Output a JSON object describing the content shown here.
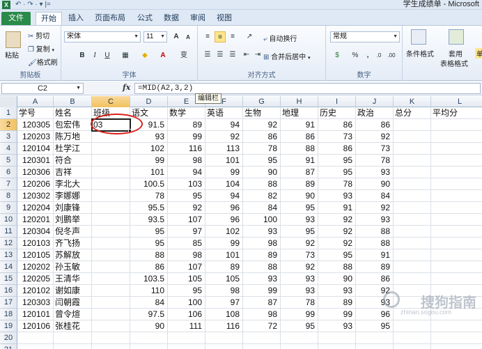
{
  "titlebar": {
    "app_icon": "X",
    "quick_access": "↶ · ↷ · ▾ |=",
    "title": "学生成绩单 - Microsoft"
  },
  "tabs": [
    "文件",
    "开始",
    "插入",
    "页面布局",
    "公式",
    "数据",
    "审阅",
    "视图"
  ],
  "clipboard": {
    "paste": "粘贴",
    "cut": "剪切",
    "copy": "复制",
    "format_painter": "格式刷",
    "label": "剪贴板"
  },
  "font": {
    "name": "宋体",
    "size": "11",
    "bold": "B",
    "italic": "I",
    "underline": "U",
    "grow": "A",
    "shrink": "A",
    "wen": "变",
    "label": "字体"
  },
  "alignment": {
    "wrap_text": "自动换行",
    "merge_center": "合并后居中",
    "label": "对齐方式"
  },
  "number": {
    "format": "常规",
    "percent": "%",
    "comma": ",",
    "inc_decimal": ".0",
    "dec_decimal": ".00",
    "label": "数字"
  },
  "styles": {
    "conditional": "条件格式",
    "table_format": "套用",
    "table_format2": "表格格式",
    "cell_styles": "单"
  },
  "formula_bar": {
    "name_box": "C2",
    "fx": "fx",
    "formula": "=MID(A2,3,2)",
    "tooltip": "编辑栏"
  },
  "columns": [
    "A",
    "B",
    "C",
    "D",
    "E",
    "F",
    "G",
    "H",
    "I",
    "J",
    "K",
    "L"
  ],
  "selected_column": "C",
  "selected_row": 2,
  "header_row": [
    "学号",
    "姓名",
    "班级",
    "语文",
    "数学",
    "英语",
    "生物",
    "地理",
    "历史",
    "政治",
    "总分",
    "平均分"
  ],
  "rows": [
    [
      "120305",
      "包宏伟",
      "03",
      "91.5",
      "89",
      "94",
      "92",
      "91",
      "86",
      "86",
      "",
      ""
    ],
    [
      "120203",
      "陈万地",
      "",
      "93",
      "99",
      "92",
      "86",
      "86",
      "73",
      "92",
      "",
      ""
    ],
    [
      "120104",
      "杜学江",
      "",
      "102",
      "116",
      "113",
      "78",
      "88",
      "86",
      "73",
      "",
      ""
    ],
    [
      "120301",
      "符合",
      "",
      "99",
      "98",
      "101",
      "95",
      "91",
      "95",
      "78",
      "",
      ""
    ],
    [
      "120306",
      "吉祥",
      "",
      "101",
      "94",
      "99",
      "90",
      "87",
      "95",
      "93",
      "",
      ""
    ],
    [
      "120206",
      "李北大",
      "",
      "100.5",
      "103",
      "104",
      "88",
      "89",
      "78",
      "90",
      "",
      ""
    ],
    [
      "120302",
      "李娜娜",
      "",
      "78",
      "95",
      "94",
      "82",
      "90",
      "93",
      "84",
      "",
      ""
    ],
    [
      "120204",
      "刘康锋",
      "",
      "95.5",
      "92",
      "96",
      "84",
      "95",
      "91",
      "92",
      "",
      ""
    ],
    [
      "120201",
      "刘鹏举",
      "",
      "93.5",
      "107",
      "96",
      "100",
      "93",
      "92",
      "93",
      "",
      ""
    ],
    [
      "120304",
      "倪冬声",
      "",
      "95",
      "97",
      "102",
      "93",
      "95",
      "92",
      "88",
      "",
      ""
    ],
    [
      "120103",
      "齐飞扬",
      "",
      "95",
      "85",
      "99",
      "98",
      "92",
      "92",
      "88",
      "",
      ""
    ],
    [
      "120105",
      "苏解放",
      "",
      "88",
      "98",
      "101",
      "89",
      "73",
      "95",
      "91",
      "",
      ""
    ],
    [
      "120202",
      "孙玉敏",
      "",
      "86",
      "107",
      "89",
      "88",
      "92",
      "88",
      "89",
      "",
      ""
    ],
    [
      "120205",
      "王清华",
      "",
      "103.5",
      "105",
      "105",
      "93",
      "93",
      "90",
      "86",
      "",
      ""
    ],
    [
      "120102",
      "谢如康",
      "",
      "110",
      "95",
      "98",
      "99",
      "93",
      "93",
      "92",
      "",
      ""
    ],
    [
      "120303",
      "闫朝霞",
      "",
      "84",
      "100",
      "97",
      "87",
      "78",
      "89",
      "93",
      "",
      ""
    ],
    [
      "120101",
      "曾令煊",
      "",
      "97.5",
      "106",
      "108",
      "98",
      "99",
      "99",
      "96",
      "",
      ""
    ],
    [
      "120106",
      "张桂花",
      "",
      "90",
      "111",
      "116",
      "72",
      "95",
      "93",
      "95",
      "",
      ""
    ]
  ],
  "empty_rows": [
    20,
    21
  ],
  "watermark": {
    "text": "搜狗指南",
    "sub": "zhinan.sogou.com"
  },
  "colors": {
    "file_tab": "#2a8a4a",
    "selection": "#f1c15f",
    "annotation": "#d9201c"
  }
}
